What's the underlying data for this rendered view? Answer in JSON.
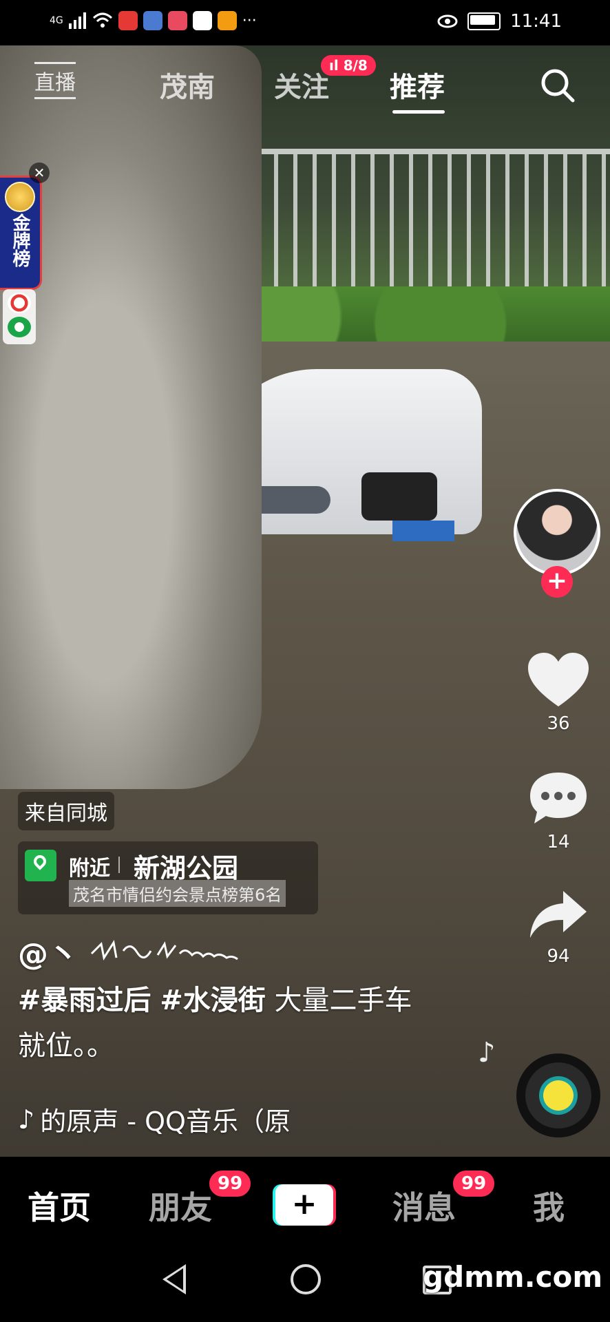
{
  "status_bar": {
    "network": "4G",
    "time": "11:41",
    "app_colors": [
      "#e53935",
      "#4a7bd1",
      "#e84a5f",
      "#ffffff",
      "#f39c12"
    ]
  },
  "top_nav": {
    "live_label": "直播",
    "tabs": [
      {
        "label": "茂南",
        "active": false
      },
      {
        "label": "关注",
        "active": false
      },
      {
        "label": "推荐",
        "active": true
      }
    ],
    "follow_badge": "8/8"
  },
  "promo": {
    "label": "金牌榜"
  },
  "actions": {
    "likes": "36",
    "comments": "14",
    "shares": "94"
  },
  "video_info": {
    "origin_tag": "来自同城",
    "poi_near": "附近",
    "poi_name": "新湖公园",
    "poi_rank": "茂名市情侣约会景点榜第6名",
    "author": "@丶",
    "hashtags": [
      "#暴雨过后",
      "#水浸街"
    ],
    "caption_text": "大量二手车就位。。",
    "music": "的原声 - QQ音乐（原"
  },
  "bottom_nav": {
    "items": [
      {
        "label": "首页",
        "active": true
      },
      {
        "label": "朋友",
        "active": false,
        "badge": "99"
      },
      {
        "label": "消息",
        "active": false,
        "badge": "99"
      },
      {
        "label": "我",
        "active": false
      }
    ]
  },
  "watermark": "gdmm.com",
  "colors": {
    "accent": "#fe2c55",
    "cyan": "#25f4ee",
    "poi_green": "#20b34e"
  }
}
